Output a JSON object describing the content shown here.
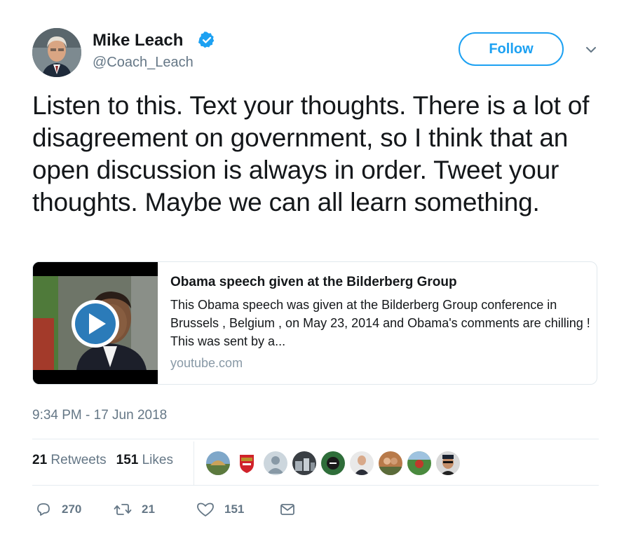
{
  "author": {
    "name": "Mike Leach",
    "handle": "@Coach_Leach",
    "verified": true
  },
  "follow_label": "Follow",
  "tweet_text": "Listen to this. Text your thoughts. There is a lot of disagreement on government, so I think that an open discussion is always in order. Tweet your thoughts. Maybe we can all learn something.",
  "card": {
    "title": "Obama speech given at the Bilderberg Group",
    "description": "This Obama speech was given at the Bilderberg Group conference in Brussels , Belgium , on May 23, 2014 and Obama's comments are chilling ! This was sent by a...",
    "domain": "youtube.com",
    "thumbnail_icon": "play-icon"
  },
  "timestamp": "9:34 PM - 17 Jun 2018",
  "stats": {
    "retweets_count": "21",
    "retweets_label": "Retweets",
    "likes_count": "151",
    "likes_label": "Likes"
  },
  "likers_count": 9,
  "actions": {
    "replies": "270",
    "retweets": "21",
    "likes": "151"
  },
  "colors": {
    "accent": "#1da1f2",
    "text": "#14171a",
    "secondary": "#657786",
    "border": "#e1e8ed"
  }
}
